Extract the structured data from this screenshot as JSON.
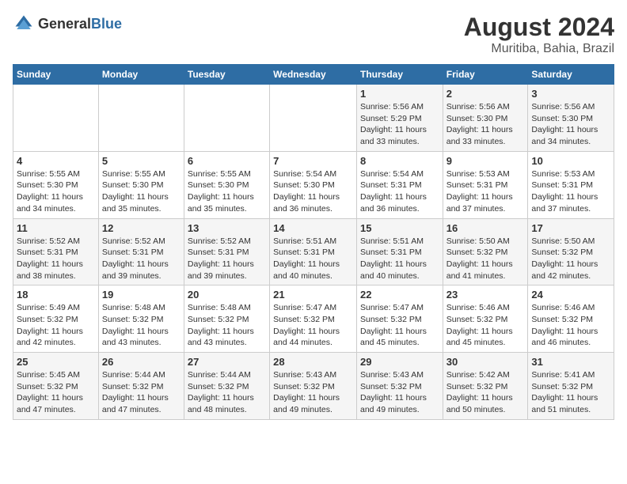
{
  "header": {
    "logo_general": "General",
    "logo_blue": "Blue",
    "month_year": "August 2024",
    "location": "Muritiba, Bahia, Brazil"
  },
  "days_of_week": [
    "Sunday",
    "Monday",
    "Tuesday",
    "Wednesday",
    "Thursday",
    "Friday",
    "Saturday"
  ],
  "weeks": [
    [
      {
        "day": "",
        "info": ""
      },
      {
        "day": "",
        "info": ""
      },
      {
        "day": "",
        "info": ""
      },
      {
        "day": "",
        "info": ""
      },
      {
        "day": "1",
        "info": "Sunrise: 5:56 AM\nSunset: 5:29 PM\nDaylight: 11 hours and 33 minutes."
      },
      {
        "day": "2",
        "info": "Sunrise: 5:56 AM\nSunset: 5:30 PM\nDaylight: 11 hours and 33 minutes."
      },
      {
        "day": "3",
        "info": "Sunrise: 5:56 AM\nSunset: 5:30 PM\nDaylight: 11 hours and 34 minutes."
      }
    ],
    [
      {
        "day": "4",
        "info": "Sunrise: 5:55 AM\nSunset: 5:30 PM\nDaylight: 11 hours and 34 minutes."
      },
      {
        "day": "5",
        "info": "Sunrise: 5:55 AM\nSunset: 5:30 PM\nDaylight: 11 hours and 35 minutes."
      },
      {
        "day": "6",
        "info": "Sunrise: 5:55 AM\nSunset: 5:30 PM\nDaylight: 11 hours and 35 minutes."
      },
      {
        "day": "7",
        "info": "Sunrise: 5:54 AM\nSunset: 5:30 PM\nDaylight: 11 hours and 36 minutes."
      },
      {
        "day": "8",
        "info": "Sunrise: 5:54 AM\nSunset: 5:31 PM\nDaylight: 11 hours and 36 minutes."
      },
      {
        "day": "9",
        "info": "Sunrise: 5:53 AM\nSunset: 5:31 PM\nDaylight: 11 hours and 37 minutes."
      },
      {
        "day": "10",
        "info": "Sunrise: 5:53 AM\nSunset: 5:31 PM\nDaylight: 11 hours and 37 minutes."
      }
    ],
    [
      {
        "day": "11",
        "info": "Sunrise: 5:52 AM\nSunset: 5:31 PM\nDaylight: 11 hours and 38 minutes."
      },
      {
        "day": "12",
        "info": "Sunrise: 5:52 AM\nSunset: 5:31 PM\nDaylight: 11 hours and 39 minutes."
      },
      {
        "day": "13",
        "info": "Sunrise: 5:52 AM\nSunset: 5:31 PM\nDaylight: 11 hours and 39 minutes."
      },
      {
        "day": "14",
        "info": "Sunrise: 5:51 AM\nSunset: 5:31 PM\nDaylight: 11 hours and 40 minutes."
      },
      {
        "day": "15",
        "info": "Sunrise: 5:51 AM\nSunset: 5:31 PM\nDaylight: 11 hours and 40 minutes."
      },
      {
        "day": "16",
        "info": "Sunrise: 5:50 AM\nSunset: 5:32 PM\nDaylight: 11 hours and 41 minutes."
      },
      {
        "day": "17",
        "info": "Sunrise: 5:50 AM\nSunset: 5:32 PM\nDaylight: 11 hours and 42 minutes."
      }
    ],
    [
      {
        "day": "18",
        "info": "Sunrise: 5:49 AM\nSunset: 5:32 PM\nDaylight: 11 hours and 42 minutes."
      },
      {
        "day": "19",
        "info": "Sunrise: 5:48 AM\nSunset: 5:32 PM\nDaylight: 11 hours and 43 minutes."
      },
      {
        "day": "20",
        "info": "Sunrise: 5:48 AM\nSunset: 5:32 PM\nDaylight: 11 hours and 43 minutes."
      },
      {
        "day": "21",
        "info": "Sunrise: 5:47 AM\nSunset: 5:32 PM\nDaylight: 11 hours and 44 minutes."
      },
      {
        "day": "22",
        "info": "Sunrise: 5:47 AM\nSunset: 5:32 PM\nDaylight: 11 hours and 45 minutes."
      },
      {
        "day": "23",
        "info": "Sunrise: 5:46 AM\nSunset: 5:32 PM\nDaylight: 11 hours and 45 minutes."
      },
      {
        "day": "24",
        "info": "Sunrise: 5:46 AM\nSunset: 5:32 PM\nDaylight: 11 hours and 46 minutes."
      }
    ],
    [
      {
        "day": "25",
        "info": "Sunrise: 5:45 AM\nSunset: 5:32 PM\nDaylight: 11 hours and 47 minutes."
      },
      {
        "day": "26",
        "info": "Sunrise: 5:44 AM\nSunset: 5:32 PM\nDaylight: 11 hours and 47 minutes."
      },
      {
        "day": "27",
        "info": "Sunrise: 5:44 AM\nSunset: 5:32 PM\nDaylight: 11 hours and 48 minutes."
      },
      {
        "day": "28",
        "info": "Sunrise: 5:43 AM\nSunset: 5:32 PM\nDaylight: 11 hours and 49 minutes."
      },
      {
        "day": "29",
        "info": "Sunrise: 5:43 AM\nSunset: 5:32 PM\nDaylight: 11 hours and 49 minutes."
      },
      {
        "day": "30",
        "info": "Sunrise: 5:42 AM\nSunset: 5:32 PM\nDaylight: 11 hours and 50 minutes."
      },
      {
        "day": "31",
        "info": "Sunrise: 5:41 AM\nSunset: 5:32 PM\nDaylight: 11 hours and 51 minutes."
      }
    ]
  ]
}
